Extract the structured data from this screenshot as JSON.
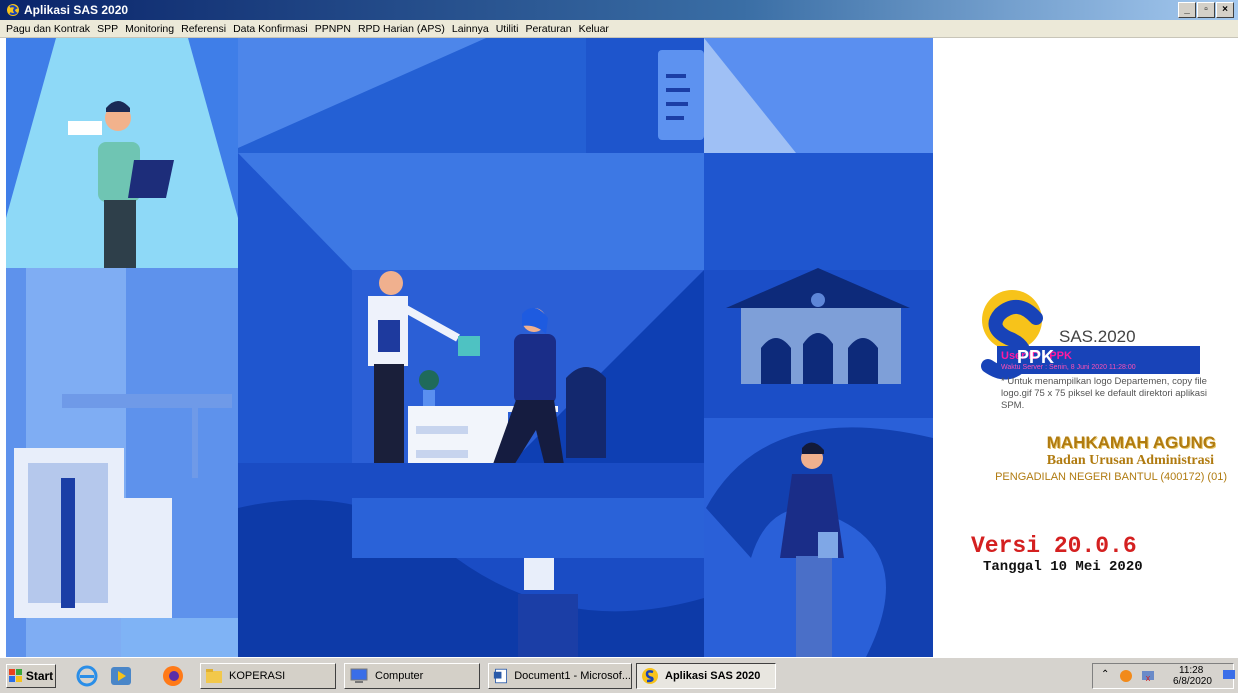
{
  "window": {
    "title": "Aplikasi SAS 2020",
    "controls": [
      "minimize-icon",
      "maximize-icon",
      "close-icon"
    ]
  },
  "menu": [
    "Pagu dan Kontrak",
    "SPP",
    "Monitoring",
    "Referensi",
    "Data Konfirmasi",
    "PPNPN",
    "RPD Harian (APS)",
    "Lainnya",
    "Utiliti",
    "Peraturan",
    "Keluar"
  ],
  "panel": {
    "app_name": "SAS.2020",
    "user_label": "User ID : PPK",
    "user_value": "PPK",
    "server_time": "Waktu Server : Senin, 8 Juni 2020 11:28:00",
    "logo_note": "* Untuk menampilkan logo Departemen, copy file logo.gif 75 x 75 piksel ke default direktori aplikasi SPM.",
    "org_line1": "MAHKAMAH AGUNG",
    "org_line2": "Badan Urusan Administrasi",
    "org_line3": "PENGADILAN NEGERI BANTUL (400172) (01)",
    "version": "Versi 20.0.6",
    "date": "Tanggal 10 Mei 2020"
  },
  "taskbar": {
    "start_label": "Start",
    "items": [
      "KOPERASI",
      "Computer",
      "Document1 - Microsof...",
      "Aplikasi SAS 2020"
    ],
    "clock_time": "11:28",
    "clock_date": "6/8/2020"
  },
  "colors": {
    "titlebar": "#0a246a",
    "menubar": "#ece9d8",
    "illustration_dark": "#1646b8",
    "illustration_light": "#7ea6ee",
    "version_red": "#d42020",
    "org_gold": "#b07b10",
    "user_box": "#1843b8"
  }
}
